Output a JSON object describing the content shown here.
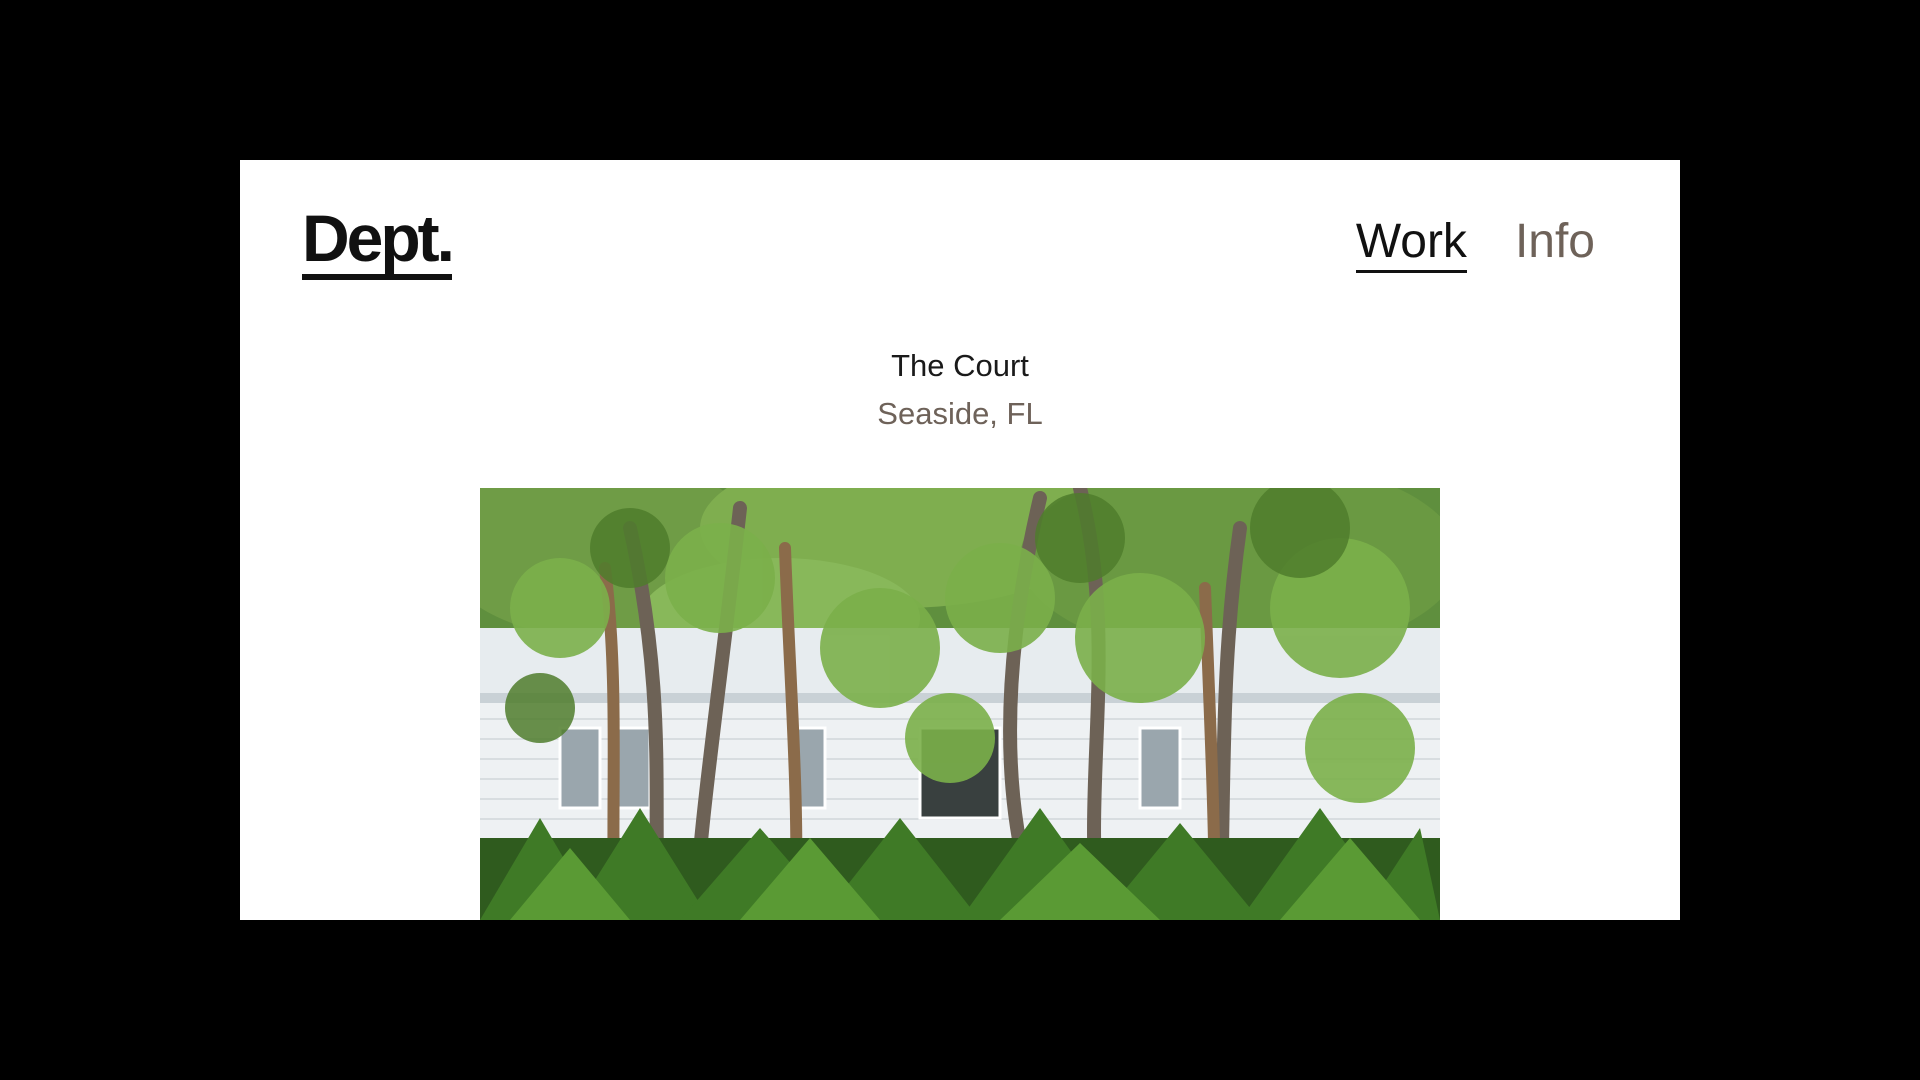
{
  "header": {
    "logo_text": "Dept.",
    "nav": [
      {
        "label": "Work",
        "active": true
      },
      {
        "label": "Info",
        "active": false
      }
    ]
  },
  "project": {
    "title": "The Court",
    "location": "Seaside, FL"
  },
  "colors": {
    "background_outer": "#000000",
    "page": "#ffffff",
    "text_primary": "#111111",
    "text_muted": "#6e6259"
  }
}
